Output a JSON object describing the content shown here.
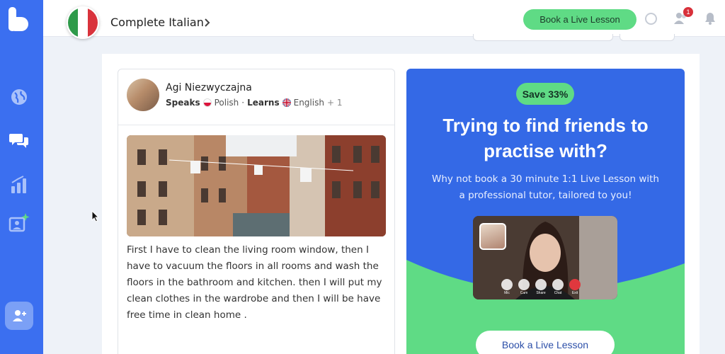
{
  "colors": {
    "sidebar": "#3b6ff0",
    "accent_green": "#5fdb85",
    "promo_blue": "#3469e6",
    "notification_red": "#d8303a"
  },
  "sidebar": {
    "icons": [
      "app-logo-icon",
      "globe-icon",
      "chat-bubbles-icon",
      "progress-chart-icon",
      "live-lesson-icon",
      "add-friend-icon"
    ]
  },
  "header": {
    "course_title": "Complete Italian",
    "book_button": "Book a Live Lesson",
    "notification_count": "1"
  },
  "post": {
    "author": "Agi Niezwyczajna",
    "speaks_label": "Speaks",
    "speaks_language": "Polish",
    "separator": "·",
    "learns_label": "Learns",
    "learns_language": "English",
    "extra_languages": "+ 1",
    "text": "First I have to clean the living room window, then I have to vacuum the floors in all rooms and wash the floors in the bathroom and kitchen. then I will put my clean clothes in the wardrobe and then I will be have free time in clean home ."
  },
  "promo": {
    "badge": "Save 33%",
    "title": "Trying to find friends to practise with?",
    "subtitle": "Why not book a 30 minute 1:1 Live Lesson with a professional tutor, tailored to you!",
    "video_controls": [
      "Mic",
      "Cam",
      "Share",
      "Chat",
      "Exit"
    ],
    "button": "Book a Live Lesson"
  }
}
